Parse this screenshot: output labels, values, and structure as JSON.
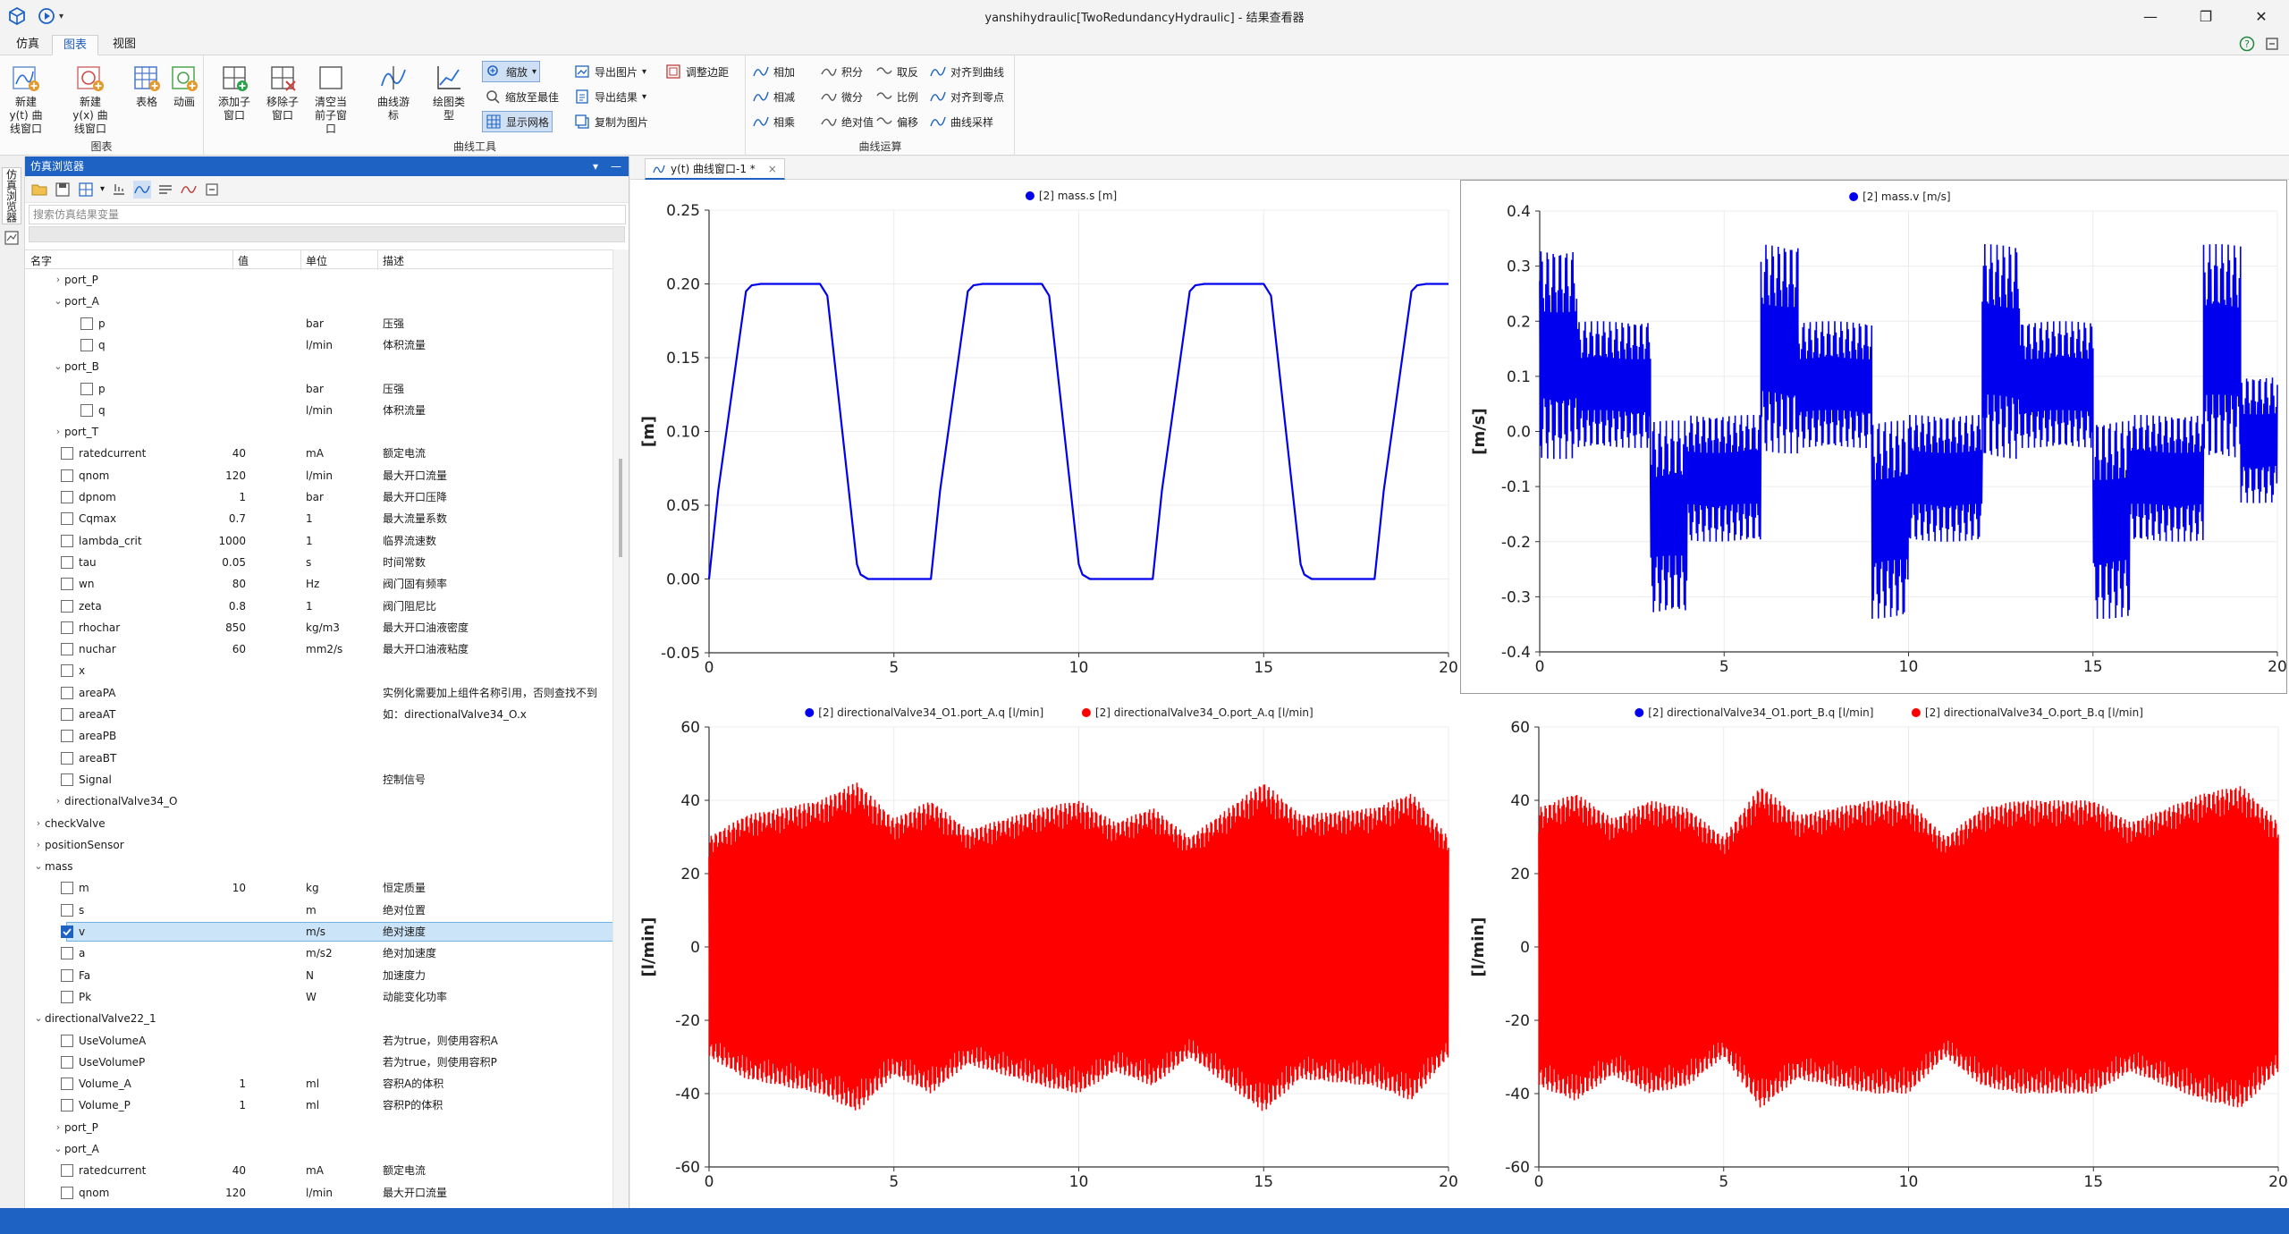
{
  "window": {
    "title": "yanshihydraulic[TwoRedundancyHydraulic] - 结果查看器",
    "min_glyph": "—",
    "max_glyph": "❐",
    "close_glyph": "✕"
  },
  "menu_tabs": [
    {
      "label": "仿真",
      "active": false
    },
    {
      "label": "图表",
      "active": true
    },
    {
      "label": "视图",
      "active": false
    }
  ],
  "ribbon": {
    "group_chart": {
      "label": "图表",
      "buttons": [
        {
          "label": "新建 y(t) 曲线窗口",
          "icon": "new-yt-window-icon"
        },
        {
          "label": "新建 y(x) 曲线窗口",
          "icon": "new-yx-window-icon"
        },
        {
          "label": "表格",
          "icon": "table-icon"
        },
        {
          "label": "动画",
          "icon": "animation-icon"
        }
      ]
    },
    "group_curve_tools": {
      "label": "曲线工具",
      "buttons": [
        {
          "label": "添加子窗口",
          "icon": "add-subwindow-icon",
          "dropdown": true
        },
        {
          "label": "移除子窗口",
          "icon": "remove-subwindow-icon",
          "dropdown": true
        },
        {
          "label": "清空当前子窗口",
          "icon": "clear-subwindow-icon"
        },
        {
          "label": "曲线游标",
          "icon": "curve-cursor-icon",
          "dropdown": true
        },
        {
          "label": "绘图类型",
          "icon": "plot-type-icon",
          "dropdown": true
        }
      ],
      "small": [
        {
          "label": "缩放",
          "icon": "zoom-icon",
          "pressed": true,
          "dropdown": true
        },
        {
          "label": "缩放至最佳",
          "icon": "zoom-fit-icon",
          "pressed": false
        },
        {
          "label": "显示网格",
          "icon": "grid-icon",
          "pressed": true
        },
        {
          "label": "导出图片",
          "icon": "export-image-icon",
          "dropdown": true
        },
        {
          "label": "导出结果",
          "icon": "export-results-icon",
          "dropdown": true
        },
        {
          "label": "复制为图片",
          "icon": "copy-image-icon"
        },
        {
          "label": "调整边距",
          "icon": "adjust-margins-icon"
        }
      ]
    },
    "group_curve_ops": {
      "label": "曲线运算",
      "small": [
        {
          "label": "相加",
          "icon": "add-curves-icon"
        },
        {
          "label": "相减",
          "icon": "subtract-curves-icon"
        },
        {
          "label": "相乘",
          "icon": "multiply-curves-icon"
        },
        {
          "label": "积分",
          "icon": "integrate-icon"
        },
        {
          "label": "微分",
          "icon": "differentiate-icon"
        },
        {
          "label": "绝对值",
          "icon": "absolute-icon"
        },
        {
          "label": "取反",
          "icon": "negate-icon"
        },
        {
          "label": "比例",
          "icon": "scale-icon"
        },
        {
          "label": "偏移",
          "icon": "offset-icon"
        },
        {
          "label": "对齐到曲线",
          "icon": "align-curve-icon"
        },
        {
          "label": "对齐到零点",
          "icon": "align-zero-icon"
        },
        {
          "label": "曲线采样",
          "icon": "sample-curve-icon"
        }
      ]
    }
  },
  "side_tab": "仿真浏览器",
  "browser": {
    "title": "仿真浏览器",
    "search_placeholder": "搜索仿真结果变量",
    "columns": [
      "名字",
      "值",
      "单位",
      "描述"
    ],
    "rows": [
      {
        "indent": 1,
        "caret": "›",
        "name": "port_P"
      },
      {
        "indent": 1,
        "caret": "⌄",
        "name": "port_A"
      },
      {
        "indent": 2,
        "checkbox": true,
        "name": "p",
        "unit": "bar",
        "desc": "压强"
      },
      {
        "indent": 2,
        "checkbox": true,
        "name": "q",
        "unit": "l/min",
        "desc": "体积流量"
      },
      {
        "indent": 1,
        "caret": "⌄",
        "name": "port_B"
      },
      {
        "indent": 2,
        "checkbox": true,
        "name": "p",
        "unit": "bar",
        "desc": "压强"
      },
      {
        "indent": 2,
        "checkbox": true,
        "name": "q",
        "unit": "l/min",
        "desc": "体积流量"
      },
      {
        "indent": 1,
        "caret": "›",
        "name": "port_T"
      },
      {
        "indent": 1,
        "checkbox": true,
        "name": "ratedcurrent",
        "value": "40",
        "unit": "mA",
        "desc": "额定电流"
      },
      {
        "indent": 1,
        "checkbox": true,
        "name": "qnom",
        "value": "120",
        "unit": "l/min",
        "desc": "最大开口流量"
      },
      {
        "indent": 1,
        "checkbox": true,
        "name": "dpnom",
        "value": "1",
        "unit": "bar",
        "desc": "最大开口压降"
      },
      {
        "indent": 1,
        "checkbox": true,
        "name": "Cqmax",
        "value": "0.7",
        "unit": "1",
        "desc": "最大流量系数"
      },
      {
        "indent": 1,
        "checkbox": true,
        "name": "lambda_crit",
        "value": "1000",
        "unit": "1",
        "desc": "临界流速数"
      },
      {
        "indent": 1,
        "checkbox": true,
        "name": "tau",
        "value": "0.05",
        "unit": "s",
        "desc": "时间常数"
      },
      {
        "indent": 1,
        "checkbox": true,
        "name": "wn",
        "value": "80",
        "unit": "Hz",
        "desc": "阀门固有频率"
      },
      {
        "indent": 1,
        "checkbox": true,
        "name": "zeta",
        "value": "0.8",
        "unit": "1",
        "desc": "阀门阻尼比"
      },
      {
        "indent": 1,
        "checkbox": true,
        "name": "rhochar",
        "value": "850",
        "unit": "kg/m3",
        "desc": "最大开口油液密度"
      },
      {
        "indent": 1,
        "checkbox": true,
        "name": "nuchar",
        "value": "60",
        "unit": "mm2/s",
        "desc": "最大开口油液粘度"
      },
      {
        "indent": 1,
        "checkbox": true,
        "name": "x"
      },
      {
        "indent": 1,
        "checkbox": true,
        "name": "areaPA",
        "desc": "实例化需要加上组件名称引用，否则查找不到"
      },
      {
        "indent": 1,
        "checkbox": true,
        "name": "areaAT",
        "desc": "如：directionalValve34_O.x"
      },
      {
        "indent": 1,
        "checkbox": true,
        "name": "areaPB"
      },
      {
        "indent": 1,
        "checkbox": true,
        "name": "areaBT"
      },
      {
        "indent": 1,
        "checkbox": true,
        "name": "Signal",
        "desc": "控制信号"
      },
      {
        "indent": 1,
        "caret": "›",
        "name": "directionalValve34_O"
      },
      {
        "indent": 0,
        "caret": "›",
        "name": "checkValve"
      },
      {
        "indent": 0,
        "caret": "›",
        "name": "positionSensor"
      },
      {
        "indent": 0,
        "caret": "⌄",
        "name": "mass"
      },
      {
        "indent": 1,
        "checkbox": true,
        "name": "m",
        "value": "10",
        "unit": "kg",
        "desc": "恒定质量"
      },
      {
        "indent": 1,
        "checkbox": true,
        "name": "s",
        "unit": "m",
        "desc": "绝对位置"
      },
      {
        "indent": 1,
        "checkbox": true,
        "checked": true,
        "selected": true,
        "name": "v",
        "unit": "m/s",
        "desc": "绝对速度"
      },
      {
        "indent": 1,
        "checkbox": true,
        "name": "a",
        "unit": "m/s2",
        "desc": "绝对加速度"
      },
      {
        "indent": 1,
        "checkbox": true,
        "name": "Fa",
        "unit": "N",
        "desc": "加速度力"
      },
      {
        "indent": 1,
        "checkbox": true,
        "name": "Pk",
        "unit": "W",
        "desc": "动能变化功率"
      },
      {
        "indent": 0,
        "caret": "⌄",
        "name": "directionalValve22_1"
      },
      {
        "indent": 1,
        "checkbox": true,
        "name": "UseVolumeA",
        "desc": "若为true，则使用容积A"
      },
      {
        "indent": 1,
        "checkbox": true,
        "name": "UseVolumeP",
        "desc": "若为true，则使用容积P"
      },
      {
        "indent": 1,
        "checkbox": true,
        "name": "Volume_A",
        "value": "1",
        "unit": "ml",
        "desc": "容积A的体积"
      },
      {
        "indent": 1,
        "checkbox": true,
        "name": "Volume_P",
        "value": "1",
        "unit": "ml",
        "desc": "容积P的体积"
      },
      {
        "indent": 1,
        "caret": "›",
        "name": "port_P"
      },
      {
        "indent": 1,
        "caret": "⌄",
        "name": "port_A"
      },
      {
        "indent": 1,
        "checkbox": true,
        "name": "ratedcurrent",
        "value": "40",
        "unit": "mA",
        "desc": "额定电流"
      },
      {
        "indent": 1,
        "checkbox": true,
        "name": "qnom",
        "value": "120",
        "unit": "l/min",
        "desc": "最大开口流量"
      }
    ]
  },
  "doc_tab": {
    "label": "y(t) 曲线窗口-1 *",
    "close": "×"
  },
  "colors": {
    "accent": "#1e63c4",
    "series_blue": "#0000ee",
    "series_red": "#ff0000",
    "panel_header": "#1e63c4"
  },
  "chart_data": [
    {
      "type": "line",
      "ylabel": "[m]",
      "xlim": [
        0,
        20
      ],
      "ylim": [
        -0.05,
        0.25
      ],
      "xticks": [
        "0",
        "5",
        "10",
        "15",
        "20"
      ],
      "yticks": [
        "-0.05",
        "0.00",
        "0.05",
        "0.10",
        "0.15",
        "0.20",
        "0.25"
      ],
      "grid": true,
      "legend_position": "top-center",
      "series": [
        {
          "name": "[2] mass.s [m]",
          "color": "#0000ee",
          "x": [
            0,
            0.25,
            1,
            1.15,
            1.4,
            3,
            3.2,
            4,
            4.1,
            4.3,
            6,
            6.25,
            7,
            7.15,
            7.4,
            9,
            9.2,
            10,
            10.1,
            10.3,
            12,
            12.25,
            13,
            13.15,
            13.4,
            15,
            15.2,
            16,
            16.1,
            16.3,
            18,
            18.25,
            19,
            19.15,
            19.4,
            20
          ],
          "values": [
            0,
            0.06,
            0.195,
            0.199,
            0.2,
            0.2,
            0.192,
            0.01,
            0.003,
            0,
            0,
            0.06,
            0.195,
            0.199,
            0.2,
            0.2,
            0.192,
            0.01,
            0.003,
            0,
            0,
            0.06,
            0.195,
            0.199,
            0.2,
            0.2,
            0.192,
            0.01,
            0.003,
            0,
            0,
            0.06,
            0.195,
            0.199,
            0.2,
            0.2
          ]
        }
      ]
    },
    {
      "type": "line",
      "ylabel": "[m/s]",
      "xlim": [
        0,
        20
      ],
      "ylim": [
        -0.4,
        0.4
      ],
      "xticks": [
        "0",
        "5",
        "10",
        "15",
        "20"
      ],
      "yticks": [
        "-0.4",
        "-0.3",
        "-0.2",
        "-0.1",
        "0.0",
        "0.1",
        "0.2",
        "0.3",
        "0.4"
      ],
      "grid": true,
      "legend_position": "top-center",
      "series": [
        {
          "name": "[2] mass.v [m/s]",
          "color": "#0000ee",
          "envelope": [
            {
              "x": [
                0,
                1
              ],
              "lo": -0.05,
              "hi": 0.33
            },
            {
              "x": [
                1,
                3
              ],
              "lo": -0.03,
              "hi": 0.2
            },
            {
              "x": [
                3,
                4
              ],
              "lo": -0.33,
              "hi": 0.02
            },
            {
              "x": [
                4,
                6
              ],
              "lo": -0.2,
              "hi": 0.03
            },
            {
              "x": [
                6,
                7
              ],
              "lo": -0.04,
              "hi": 0.34
            },
            {
              "x": [
                7,
                9
              ],
              "lo": -0.03,
              "hi": 0.2
            },
            {
              "x": [
                9,
                10
              ],
              "lo": -0.34,
              "hi": 0.02
            },
            {
              "x": [
                10,
                12
              ],
              "lo": -0.2,
              "hi": 0.03
            },
            {
              "x": [
                12,
                13
              ],
              "lo": -0.05,
              "hi": 0.34
            },
            {
              "x": [
                13,
                15
              ],
              "lo": -0.03,
              "hi": 0.2
            },
            {
              "x": [
                15,
                16
              ],
              "lo": -0.34,
              "hi": 0.02
            },
            {
              "x": [
                16,
                18
              ],
              "lo": -0.2,
              "hi": 0.03
            },
            {
              "x": [
                18,
                19
              ],
              "lo": -0.05,
              "hi": 0.34
            },
            {
              "x": [
                19,
                20
              ],
              "lo": -0.13,
              "hi": 0.1
            }
          ]
        }
      ]
    },
    {
      "type": "line",
      "ylabel": "[l/min]",
      "xlim": [
        0,
        20
      ],
      "ylim": [
        -60,
        60
      ],
      "xticks": [
        "0",
        "5",
        "10",
        "15",
        "20"
      ],
      "yticks": [
        "-60",
        "-40",
        "-20",
        "0",
        "20",
        "40",
        "60"
      ],
      "grid": true,
      "legend_position": "top-center",
      "series": [
        {
          "name": "[2] directionalValve34_O1.port_A.q [l/min]",
          "color": "#0000ee",
          "values": []
        },
        {
          "name": "[2] directionalValve34_O.port_A.q [l/min]",
          "color": "#ff0000",
          "envelope_amplitude": [
            [
              0,
              30
            ],
            [
              1,
              36
            ],
            [
              3,
              40
            ],
            [
              4,
              45
            ],
            [
              5,
              35
            ],
            [
              6,
              40
            ],
            [
              7,
              32
            ],
            [
              9,
              38
            ],
            [
              10,
              40
            ],
            [
              11,
              34
            ],
            [
              12,
              38
            ],
            [
              13,
              30
            ],
            [
              15,
              45
            ],
            [
              16,
              36
            ],
            [
              18,
              38
            ],
            [
              19,
              42
            ],
            [
              20,
              30
            ]
          ]
        }
      ]
    },
    {
      "type": "line",
      "ylabel": "[l/min]",
      "xlim": [
        0,
        20
      ],
      "ylim": [
        -60,
        60
      ],
      "xticks": [
        "0",
        "5",
        "10",
        "15",
        "20"
      ],
      "yticks": [
        "-60",
        "-40",
        "-20",
        "0",
        "20",
        "40",
        "60"
      ],
      "grid": true,
      "legend_position": "top-center",
      "series": [
        {
          "name": "[2] directionalValve34_O1.port_B.q [l/min]",
          "color": "#0000ee",
          "values": []
        },
        {
          "name": "[2] directionalValve34_O.port_B.q [l/min]",
          "color": "#ff0000",
          "envelope_amplitude": [
            [
              0,
              38
            ],
            [
              1,
              42
            ],
            [
              2,
              35
            ],
            [
              3,
              40
            ],
            [
              4,
              38
            ],
            [
              5,
              30
            ],
            [
              6,
              44
            ],
            [
              7,
              36
            ],
            [
              9,
              40
            ],
            [
              10,
              40
            ],
            [
              11,
              30
            ],
            [
              12,
              38
            ],
            [
              13,
              40
            ],
            [
              15,
              40
            ],
            [
              16,
              34
            ],
            [
              18,
              42
            ],
            [
              19,
              44
            ],
            [
              20,
              34
            ]
          ]
        }
      ]
    }
  ]
}
